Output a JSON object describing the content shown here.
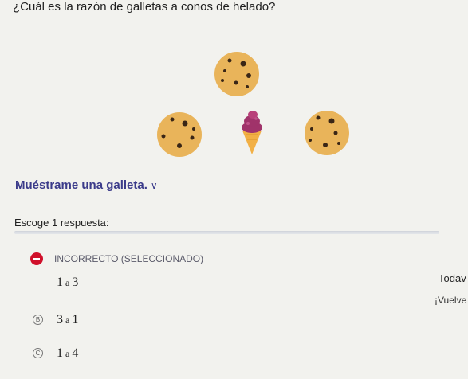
{
  "question": {
    "title": "¿Cuál es la razón de galletas a conos de helado?"
  },
  "prompt": {
    "text": "Muéstrame una galleta."
  },
  "answer_area": {
    "choose_label": "Escoge 1 respuesta:",
    "status_label": "INCORRECTO (SELECCIONADO)",
    "options": [
      {
        "letter": "",
        "left": "1",
        "sep": "a",
        "right": "3",
        "selected": true
      },
      {
        "letter": "B",
        "left": "3",
        "sep": "a",
        "right": "1",
        "selected": false
      },
      {
        "letter": "C",
        "left": "1",
        "sep": "a",
        "right": "4",
        "selected": false
      }
    ]
  },
  "side_panel": {
    "title": "Todav",
    "subtitle": "¡Vuelve"
  },
  "colors": {
    "accent": "#3b3b8a",
    "incorrect": "#d0102a",
    "cookie": "#e9b45a",
    "chip": "#3a2616",
    "cone": "#f2b045",
    "icecream": "#a0336a"
  },
  "icons": [
    "cookie-icon",
    "ice-cream-cone-icon",
    "chevron-down-icon",
    "incorrect-icon"
  ]
}
